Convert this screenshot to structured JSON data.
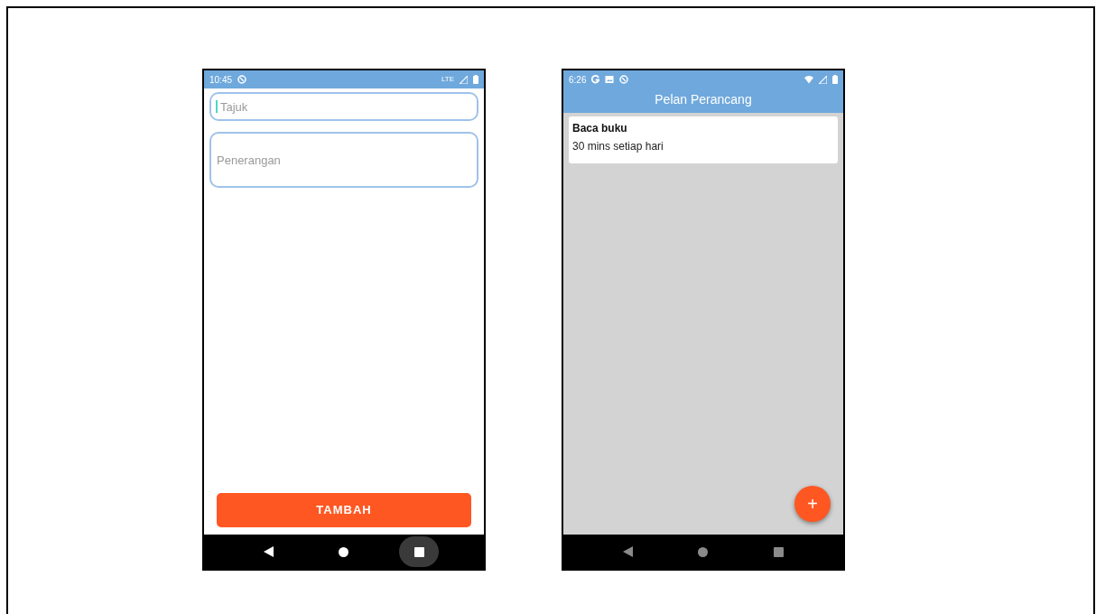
{
  "phones": [
    {
      "kind": "form",
      "status_bar": {
        "time": "10:45",
        "network": "LTE"
      },
      "fields": [
        {
          "kind": "single",
          "placeholder": "Tajuk",
          "focused": true
        },
        {
          "kind": "multi",
          "placeholder": "Penerangan",
          "focused": false
        }
      ],
      "button": "TAMBAH",
      "nav": {
        "dimmed": false,
        "recents_pressed": true
      }
    },
    {
      "kind": "list",
      "status_bar": {
        "time": "6:26"
      },
      "title": "Pelan Perancang",
      "cards": [
        {
          "title": "Baca buku",
          "description": "30 mins setiap hari"
        }
      ],
      "fab": "+",
      "nav": {
        "dimmed": true,
        "recents_pressed": false
      }
    }
  ]
}
